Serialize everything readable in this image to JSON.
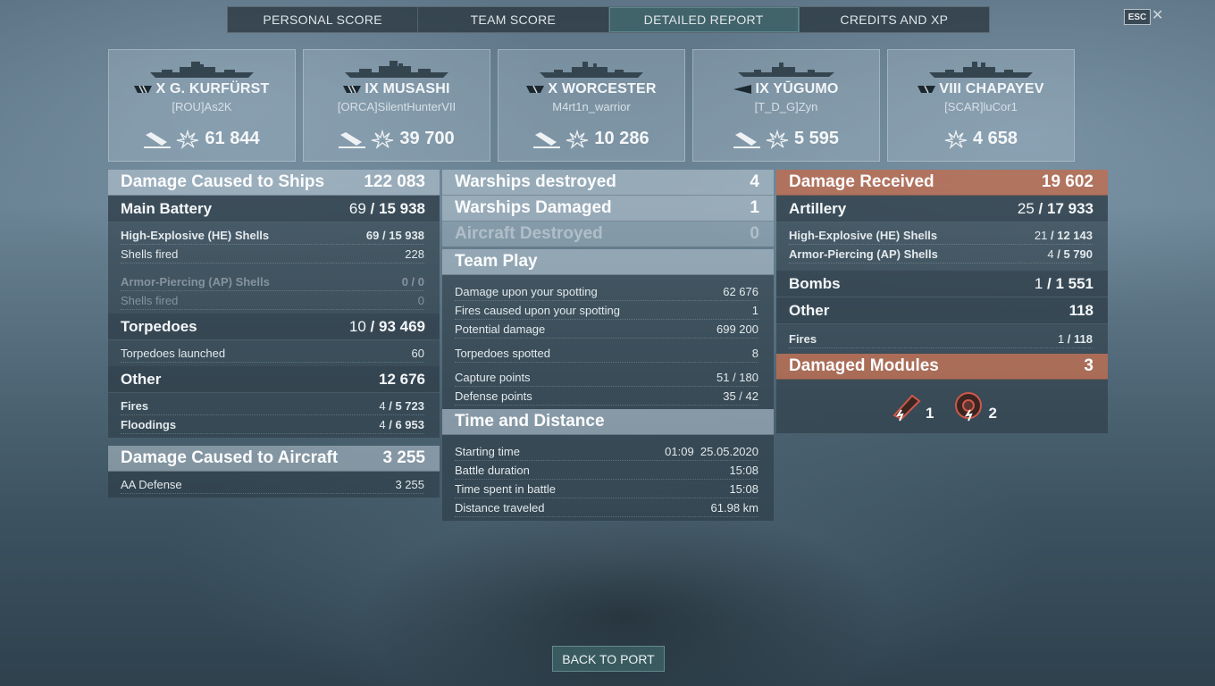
{
  "tabs": [
    "PERSONAL SCORE",
    "TEAM SCORE",
    "DETAILED REPORT",
    "CREDITS AND XP"
  ],
  "active_tab": 2,
  "esc_label": "ESC",
  "close_icon": "✕",
  "cards": [
    {
      "ship": "X G. KURFÜRST",
      "player": "[ROU]As2K",
      "damage": "61 844",
      "class_icon": "battleship-icon"
    },
    {
      "ship": "IX MUSASHI",
      "player": "[ORCA]SilentHunterVII",
      "damage": "39 700",
      "class_icon": "battleship-icon"
    },
    {
      "ship": "X WORCESTER",
      "player": "M4rt1n_warrior",
      "damage": "10 286",
      "class_icon": "cruiser-icon"
    },
    {
      "ship": "IX YŪGUMO",
      "player": "[T_D_G]Zyn",
      "damage": "5 595",
      "class_icon": "destroyer-icon"
    },
    {
      "ship": "VIII CHAPAYEV",
      "player": "[SCAR]luCor1",
      "damage": "4 658",
      "class_icon": "cruiser-icon"
    }
  ],
  "left": {
    "damage_ships": {
      "label": "Damage Caused to Ships",
      "value": "122 083"
    },
    "main_battery": {
      "label": "Main Battery",
      "hits": "69",
      "total": "15 938"
    },
    "he": {
      "label": "High-Explosive (HE) Shells",
      "hits": "69",
      "total": "15 938"
    },
    "he_fired": {
      "label": "Shells fired",
      "value": "228"
    },
    "ap": {
      "label": "Armor-Piercing (AP) Shells",
      "hits": "0",
      "total": "0"
    },
    "ap_fired": {
      "label": "Shells fired",
      "value": "0"
    },
    "torpedoes": {
      "label": "Torpedoes",
      "hits": "10",
      "total": "93 469"
    },
    "torp_launched": {
      "label": "Torpedoes launched",
      "value": "60"
    },
    "other": {
      "label": "Other",
      "value": "12 676"
    },
    "fires": {
      "label": "Fires",
      "hits": "4",
      "total": "5 723"
    },
    "floodings": {
      "label": "Floodings",
      "hits": "4",
      "total": "6 953"
    },
    "damage_aircraft": {
      "label": "Damage Caused to Aircraft",
      "value": "3 255"
    },
    "aa": {
      "label": "AA Defense",
      "value": "3 255"
    }
  },
  "middle": {
    "destroyed": {
      "label": "Warships destroyed",
      "value": "4"
    },
    "damaged": {
      "label": "Warships Damaged",
      "value": "1"
    },
    "aircraft": {
      "label": "Aircraft Destroyed",
      "value": "0"
    },
    "team_play": "Team Play",
    "tp_rows": [
      {
        "label": "Damage upon your spotting",
        "value": "62 676"
      },
      {
        "label": "Fires caused upon your spotting",
        "value": "1"
      },
      {
        "label": "Potential damage",
        "value": "699 200"
      },
      {
        "label": "Torpedoes spotted",
        "value": "8"
      },
      {
        "label": "Capture points",
        "value": "51 / 180"
      },
      {
        "label": "Defense points",
        "value": "35 / 42"
      }
    ],
    "time_distance": "Time and Distance",
    "td_rows": [
      {
        "label": "Starting time",
        "value": "01:09  25.05.2020"
      },
      {
        "label": "Battle duration",
        "value": "15:08"
      },
      {
        "label": "Time spent in battle",
        "value": "15:08"
      },
      {
        "label": "Distance traveled",
        "value": "61.98 km"
      }
    ]
  },
  "right": {
    "received": {
      "label": "Damage Received",
      "value": "19 602"
    },
    "artillery": {
      "label": "Artillery",
      "hits": "25",
      "total": "17 933"
    },
    "he": {
      "label": "High-Explosive (HE) Shells",
      "hits": "21",
      "total": "12 143"
    },
    "ap": {
      "label": "Armor-Piercing (AP) Shells",
      "hits": "4",
      "total": "5 790"
    },
    "bombs": {
      "label": "Bombs",
      "hits": "1",
      "total": "1 551"
    },
    "other": {
      "label": "Other",
      "value": "118"
    },
    "fires": {
      "label": "Fires",
      "hits": "1",
      "total": "118"
    },
    "modules": {
      "label": "Damaged Modules",
      "value": "3"
    },
    "module_counts": [
      "1",
      "2"
    ]
  },
  "back_button": "BACK TO PORT",
  "colors": {
    "accent_orange": "#be6e50",
    "active_tab": "#466e73"
  }
}
